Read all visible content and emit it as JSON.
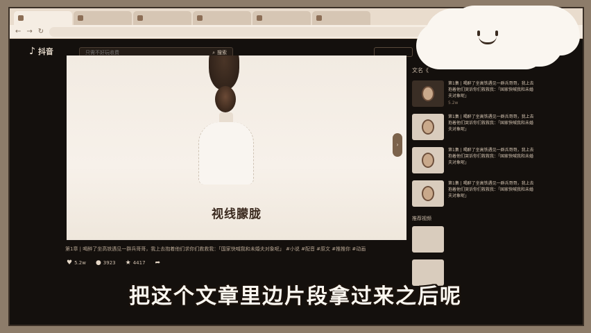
{
  "browser": {
    "tabs": [
      "",
      "",
      "",
      "",
      "",
      "",
      "",
      ""
    ],
    "url": ""
  },
  "header": {
    "logo": "抖音",
    "search_placeholder": "只需不好玩收费",
    "search_button": "搜索",
    "right_button": ""
  },
  "video": {
    "subtitle": "视线朦胧",
    "toggle_icon": "chevron-right"
  },
  "caption": "第1章 | 喝醉了坐高铁遇见一群兵哥哥，我上去抱着他们求你们救救我：「国家快喊我和未婚夫对象呢」 #小说 #配音 #原文 #推推你 #动画",
  "stats": {
    "likes": "5.2w",
    "comments": "3923",
    "stars": "4417"
  },
  "meta": "",
  "sidebar": {
    "title": "文名《",
    "items": [
      {
        "text": "第1集 | 喝醉了坐高铁遇见一群兵哥哥，我上去抱着他们哭诉你们救救我：「国家快喊我和未婚夫对象呢」",
        "count": "5.2w"
      },
      {
        "text": "第1集 | 喝醉了坐高铁遇见一群兵哥哥，我上去抱着他们哭诉你们救救我：「国家快喊我和未婚夫对象呢」",
        "count": ""
      },
      {
        "text": "第1集 | 喝醉了坐高铁遇见一群兵哥哥，我上去抱着他们哭诉你们救救我：「国家快喊我和未婚夫对象呢」",
        "count": ""
      },
      {
        "text": "第1集 | 喝醉了坐高铁遇见一群兵哥哥，我上去抱着他们哭诉你们救救我：「国家快喊我和未婚夫对象呢」",
        "count": ""
      }
    ],
    "related_title": "推荐视频"
  },
  "overlay_subtitle": "把这个文章里边片段拿过来之后呢"
}
